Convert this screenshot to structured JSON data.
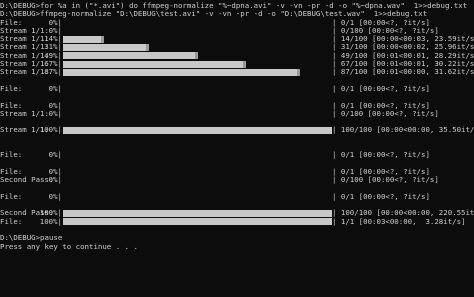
{
  "console": {
    "lines": [
      {
        "type": "text",
        "text": "D:\\DEBUG>for %a in (\"*.avi\") do ffmpeg-normalize \"%~dpna.avi\" -v -vn -pr -d -o \"%~dpna.wav\"  1>>debug.txt"
      },
      {
        "type": "text",
        "text": "D:\\DEBUG>ffmpeg-normalize \"D:\\DEBUG\\test.avi\" -v -vn -pr -d -o \"D:\\DEBUG\\test.wav\"  1>>debug.txt"
      },
      {
        "type": "progress",
        "label": "File:",
        "percent_text": "0%|",
        "progress": 0.0,
        "suffix": "| 0/1 [00:00<?, ?it/s]"
      },
      {
        "type": "progress",
        "label": "Stream 1/1:",
        "percent_text": "0%|",
        "progress": 0.0,
        "suffix": "| 0/100 [00:00<?, ?it/s]"
      },
      {
        "type": "progress",
        "label": "Stream 1/1:",
        "percent_text": "14%|",
        "progress": 0.14,
        "suffix": "| 14/100 [00:00<00:03, 23.59it/s]"
      },
      {
        "type": "progress",
        "label": "Stream 1/1:",
        "percent_text": "31%|",
        "progress": 0.31,
        "suffix": "| 31/100 [00:00<00:02, 25.96it/s]"
      },
      {
        "type": "progress",
        "label": "Stream 1/1:",
        "percent_text": "49%|",
        "progress": 0.49,
        "suffix": "| 49/100 [00:01<00:01, 28.29it/s]"
      },
      {
        "type": "progress",
        "label": "Stream 1/1:",
        "percent_text": "67%|",
        "progress": 0.67,
        "suffix": "| 67/100 [00:01<00:01, 30.22it/s]"
      },
      {
        "type": "progress",
        "label": "Stream 1/1:",
        "percent_text": "87%|",
        "progress": 0.87,
        "suffix": "| 87/100 [00:01<00:00, 31.62it/s]"
      },
      {
        "type": "blank"
      },
      {
        "type": "progress",
        "label": "File:",
        "percent_text": "0%|",
        "progress": 0.0,
        "suffix": "| 0/1 [00:00<?, ?it/s]"
      },
      {
        "type": "blank"
      },
      {
        "type": "progress",
        "label": "File:",
        "percent_text": "0%|",
        "progress": 0.0,
        "suffix": "| 0/1 [00:00<?, ?it/s]"
      },
      {
        "type": "progress",
        "label": "Stream 1/1:",
        "percent_text": "0%|",
        "progress": 0.0,
        "suffix": "| 0/100 [00:00<?, ?it/s]"
      },
      {
        "type": "blank"
      },
      {
        "type": "progress",
        "label": "Stream 1/1:",
        "percent_text": "100%|",
        "progress": 1.0,
        "suffix": "| 100/100 [00:00<00:00, 35.50it/s]"
      },
      {
        "type": "blank"
      },
      {
        "type": "blank"
      },
      {
        "type": "progress",
        "label": "File:",
        "percent_text": "0%|",
        "progress": 0.0,
        "suffix": "| 0/1 [00:00<?, ?it/s]"
      },
      {
        "type": "blank"
      },
      {
        "type": "progress",
        "label": "File:",
        "percent_text": "0%|",
        "progress": 0.0,
        "suffix": "| 0/1 [00:00<?, ?it/s]"
      },
      {
        "type": "progress",
        "label": "Second Pass:",
        "percent_text": "0%|",
        "progress": 0.0,
        "suffix": "| 0/100 [00:00<?, ?it/s]"
      },
      {
        "type": "blank"
      },
      {
        "type": "progress",
        "label": "File:",
        "percent_text": "0%|",
        "progress": 0.0,
        "suffix": "| 0/1 [00:00<?, ?it/s]"
      },
      {
        "type": "blank"
      },
      {
        "type": "progress",
        "label": "Second Pass:",
        "percent_text": "100%|",
        "progress": 1.0,
        "suffix": "| 100/100 [00:00<00:00, 220.55it/s]"
      },
      {
        "type": "progress",
        "label": "File:",
        "percent_text": "100%|",
        "progress": 1.0,
        "suffix": "| 1/1 [00:03<00:00,  3.28it/s]"
      },
      {
        "type": "blank"
      },
      {
        "type": "text",
        "text": "D:\\DEBUG>pause"
      },
      {
        "type": "text",
        "text": "Press any key to continue . . ."
      }
    ]
  }
}
